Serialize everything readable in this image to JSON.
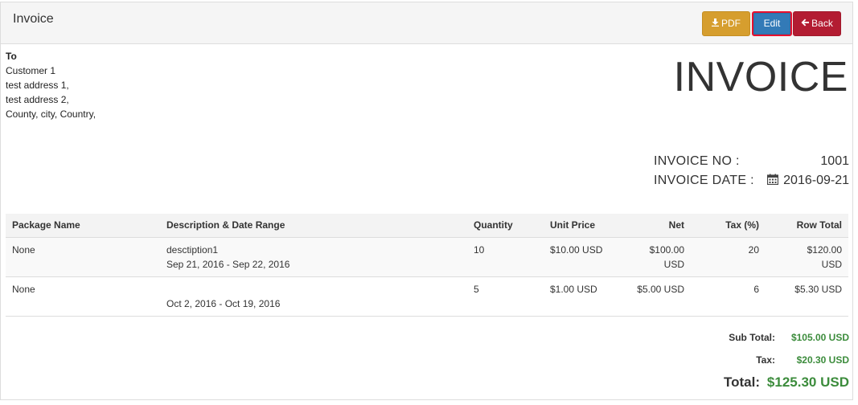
{
  "header": {
    "title": "Invoice",
    "pdf_label": "PDF",
    "edit_label": "Edit",
    "back_label": "Back"
  },
  "to": {
    "label": "To",
    "name": "Customer 1",
    "address1": "test address 1,",
    "address2": "test address 2,",
    "address3": "County, city, Country,"
  },
  "invoice": {
    "heading": "INVOICE",
    "no_label": "INVOICE NO :",
    "no_value": "1001",
    "date_label": "INVOICE DATE :",
    "date_value": "2016-09-21"
  },
  "table": {
    "columns": [
      "Package Name",
      "Description & Date Range",
      "Quantity",
      "Unit Price",
      "Net",
      "Tax (%)",
      "Row Total"
    ],
    "rows": [
      {
        "package": "None",
        "description": "desctiption1",
        "date_range": "Sep 21, 2016 - Sep 22, 2016",
        "quantity": "10",
        "unit_price": "$10.00 USD",
        "net_amount": "$100.00",
        "net_currency": "USD",
        "tax": "20",
        "total_amount": "$120.00",
        "total_currency": "USD"
      },
      {
        "package": "None",
        "description": "",
        "date_range": "Oct 2, 2016 - Oct 19, 2016",
        "quantity": "5",
        "unit_price": "$1.00 USD",
        "net": "$5.00 USD",
        "tax": "6",
        "total": "$5.30 USD"
      }
    ]
  },
  "totals": {
    "sub_label": "Sub Total:",
    "sub_value": "$105.00 USD",
    "tax_label": "Tax:",
    "tax_value": "$20.30 USD",
    "total_label": "Total:",
    "total_value": "$125.30 USD"
  },
  "colors": {
    "pdf_button": "#d69e2e",
    "edit_button": "#337ab7",
    "back_button": "#b31c32",
    "totals_green": "#3c8c3c"
  }
}
